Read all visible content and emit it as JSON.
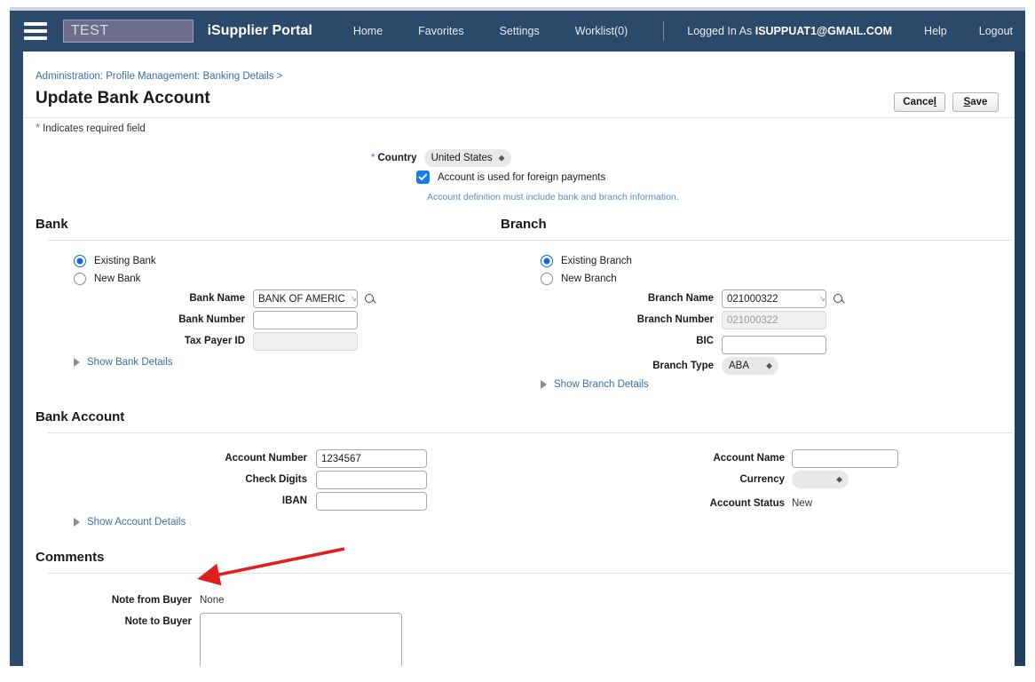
{
  "topbar": {
    "menu_icon": "hamburger-icon",
    "env_chip": "TEST",
    "brand": "iSupplier Portal",
    "nav": [
      {
        "label": "Home"
      },
      {
        "label": "Favorites"
      },
      {
        "label": "Settings"
      },
      {
        "label": "Worklist(0)"
      }
    ],
    "logged_in_prefix": "Logged In As",
    "logged_in_user": "ISUPPUAT1@GMAIL.COM",
    "right_links": [
      {
        "label": "Help"
      },
      {
        "label": "Logout"
      }
    ],
    "bg_color": "#2b4a6b"
  },
  "page": {
    "breadcrumb": "Administration: Profile Management: Banking Details  >",
    "title": "Update Bank Account",
    "cancel_label": "Cancel",
    "save_label": "Save",
    "required_note": "Indicates required field",
    "required_star": "*"
  },
  "country": {
    "label": "Country",
    "value": "United States",
    "options": [
      "United States"
    ],
    "checkbox_label": "Account is used for foreign payments",
    "checkbox_checked": true,
    "hint": "Account definition must include bank and branch information."
  },
  "bank": {
    "heading": "Bank",
    "radio_existing": "Existing Bank",
    "radio_new": "New Bank",
    "selected": "existing",
    "fields": [
      {
        "label": "Bank Name",
        "value": "BANK OF AMERIC",
        "disabled": false,
        "lov": true
      },
      {
        "label": "Bank Number",
        "value": "",
        "disabled": false,
        "lov": false
      },
      {
        "label": "Tax Payer ID",
        "value": "",
        "disabled": true,
        "lov": false
      }
    ],
    "disclosure": "Show Bank Details"
  },
  "branch": {
    "heading": "Branch",
    "radio_existing": "Existing Branch",
    "radio_new": "New Branch",
    "selected": "existing",
    "fields": [
      {
        "label": "Branch Name",
        "value": "021000322",
        "disabled": false,
        "lov": true
      },
      {
        "label": "Branch Number",
        "value": "021000322",
        "disabled": true,
        "lov": false
      },
      {
        "label": "BIC",
        "value": "",
        "disabled": false,
        "lov": false
      }
    ],
    "branch_type_label": "Branch Type",
    "branch_type_value": "ABA",
    "branch_type_options": [
      "ABA"
    ],
    "disclosure": "Show Branch Details"
  },
  "bank_account": {
    "heading": "Bank Account",
    "left_fields": [
      {
        "label": "Account Number",
        "value": "1234567"
      },
      {
        "label": "Check Digits",
        "value": ""
      },
      {
        "label": "IBAN",
        "value": ""
      }
    ],
    "right": {
      "account_name_label": "Account Name",
      "account_name_value": "",
      "currency_label": "Currency",
      "currency_value": "",
      "currency_options": [
        ""
      ],
      "status_label": "Account Status",
      "status_value": "New"
    },
    "disclosure": "Show Account Details"
  },
  "comments": {
    "heading": "Comments",
    "note_from_buyer_label": "Note from Buyer",
    "note_from_buyer_value": "None",
    "note_to_buyer_label": "Note to Buyer",
    "note_to_buyer_value": ""
  },
  "annotation": {
    "arrow_color": "#e02020",
    "points_to": "Show Account Details"
  }
}
